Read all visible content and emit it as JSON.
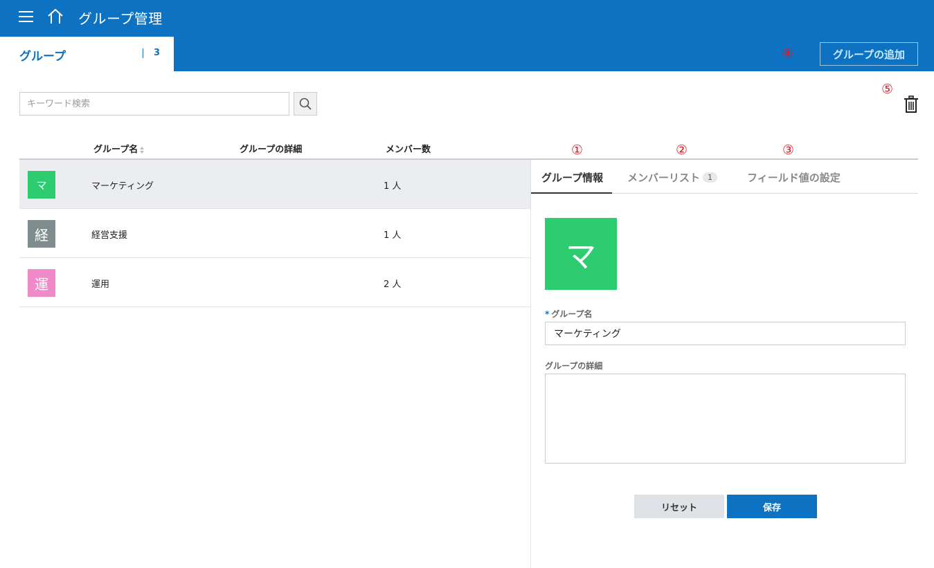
{
  "header": {
    "title": "グループ管理",
    "menu_icon": "hamburger-menu-icon",
    "home_icon": "home-icon"
  },
  "tabbar": {
    "tab_label": "グループ",
    "tab_count": "3",
    "add_button_label": "グループの追加"
  },
  "annotations": {
    "a1": "①",
    "a2": "②",
    "a3": "③",
    "a4": "④",
    "a5": "⑤"
  },
  "search": {
    "placeholder": "キーワード検索",
    "value": ""
  },
  "table": {
    "columns": [
      "グループ名",
      "グループの詳細",
      "メンバー数"
    ],
    "rows": [
      {
        "avatar": "マ",
        "avatar_color": "#2ecc71",
        "name": "マーケティング",
        "detail": "",
        "count": "1 人"
      },
      {
        "avatar": "経",
        "avatar_color": "#7f8c8d",
        "name": "経営支援",
        "detail": "",
        "count": "1 人"
      },
      {
        "avatar": "運",
        "avatar_color": "#f08ac8",
        "name": "運用",
        "detail": "",
        "count": "2 人"
      }
    ]
  },
  "detail": {
    "tabs": [
      {
        "label": "グループ情報"
      },
      {
        "label": "メンバーリスト",
        "badge": "1"
      },
      {
        "label": "フィールド値の設定"
      }
    ],
    "avatar": "マ",
    "required_mark": "*",
    "name_label": "グループ名",
    "name_value": "マーケティング",
    "desc_label": "グループの詳細",
    "desc_value": "",
    "reset_label": "リセット",
    "save_label": "保存"
  },
  "colors": {
    "brand": "#0d72c1",
    "annotation": "#e0191f"
  }
}
